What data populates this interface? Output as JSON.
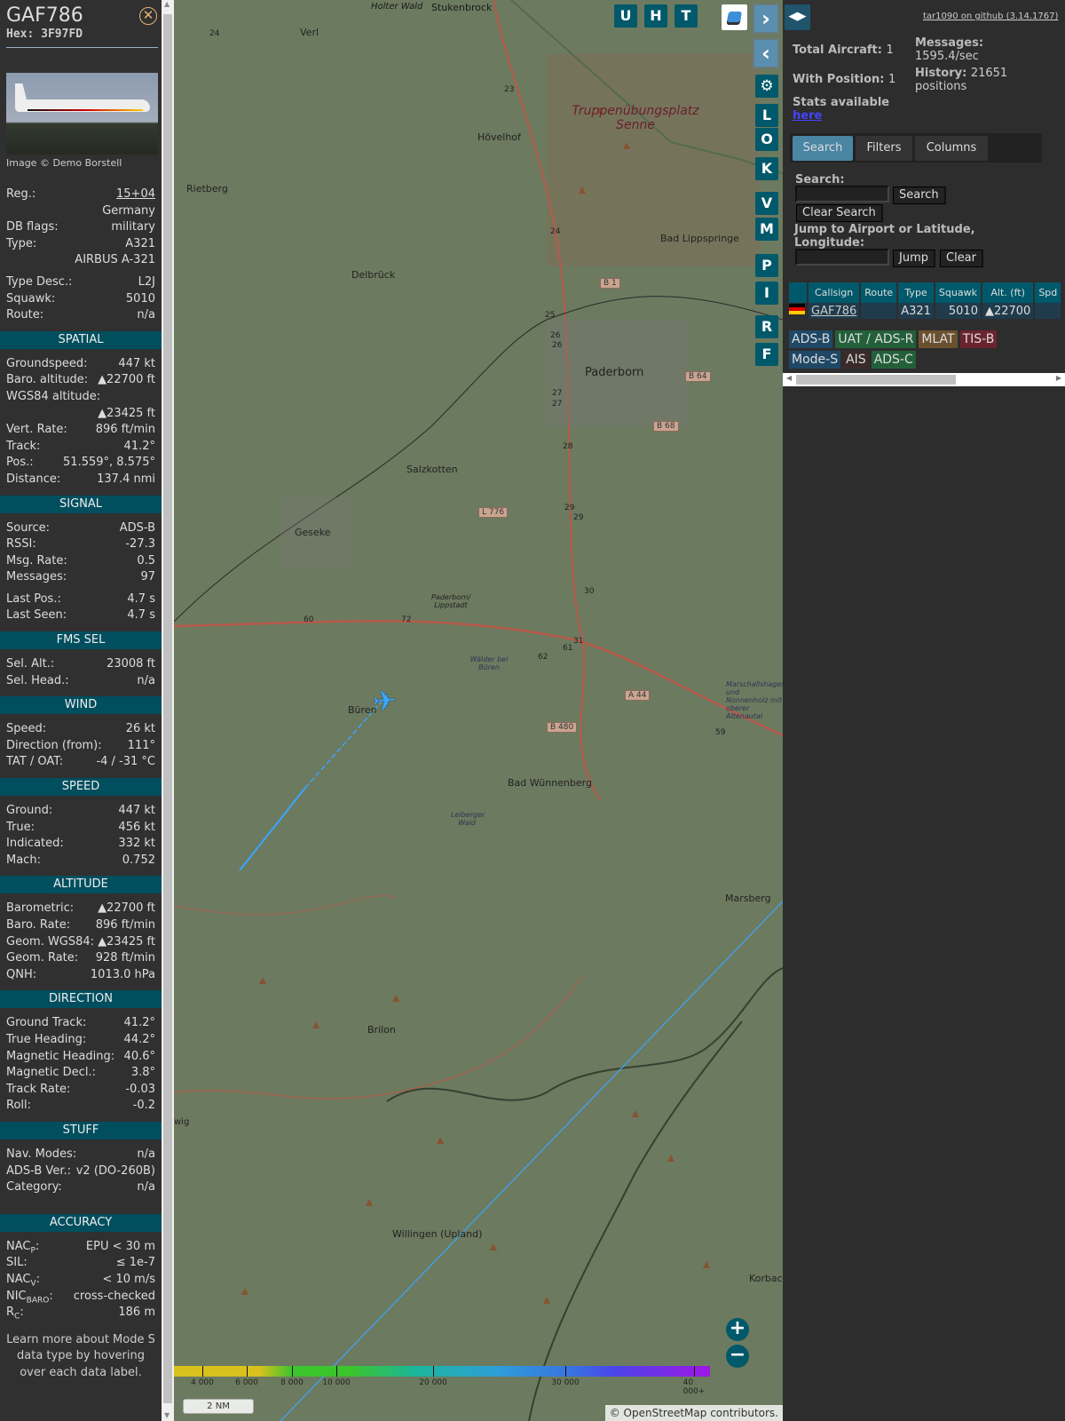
{
  "aircraft": {
    "callsign": "GAF786",
    "hex_label": "Hex: 3F97FD",
    "close_icon": "close-circle-icon",
    "image_caption": "Image © Demo Borstell"
  },
  "details": [
    {
      "type": "row",
      "label": "Reg.:",
      "value": "15+04",
      "link": true
    },
    {
      "type": "row",
      "label": "",
      "value": "Germany"
    },
    {
      "type": "row",
      "label": "DB flags:",
      "value": "military"
    },
    {
      "type": "row",
      "label": "Type:",
      "value": "A321"
    },
    {
      "type": "row",
      "label": "",
      "value": "AIRBUS A-321"
    },
    {
      "type": "gap"
    },
    {
      "type": "row",
      "label": "Type Desc.:",
      "value": "L2J"
    },
    {
      "type": "row",
      "label": "Squawk:",
      "value": "5010"
    },
    {
      "type": "row",
      "label": "Route:",
      "value": "n/a"
    },
    {
      "type": "section",
      "label": "SPATIAL"
    },
    {
      "type": "row",
      "label": "Groundspeed:",
      "value": "447 kt"
    },
    {
      "type": "row",
      "label": "Baro. altitude:",
      "value": "▲22700 ft"
    },
    {
      "type": "row",
      "label": "WGS84 altitude:",
      "value": ""
    },
    {
      "type": "row",
      "label": "",
      "value": "▲23425 ft"
    },
    {
      "type": "row",
      "label": "Vert. Rate:",
      "value": "896 ft/min"
    },
    {
      "type": "row",
      "label": "Track:",
      "value": "41.2°"
    },
    {
      "type": "row",
      "label": "Pos.:",
      "value": "51.559°, 8.575°"
    },
    {
      "type": "row",
      "label": "Distance:",
      "value": "137.4 nmi"
    },
    {
      "type": "section",
      "label": "SIGNAL"
    },
    {
      "type": "row",
      "label": "Source:",
      "value": "ADS-B"
    },
    {
      "type": "row",
      "label": "RSSI:",
      "value": "-27.3"
    },
    {
      "type": "row",
      "label": "Msg. Rate:",
      "value": "0.5"
    },
    {
      "type": "row",
      "label": "Messages:",
      "value": "97"
    },
    {
      "type": "gap"
    },
    {
      "type": "row",
      "label": "Last Pos.:",
      "value": "4.7 s"
    },
    {
      "type": "row",
      "label": "Last Seen:",
      "value": "4.7 s"
    },
    {
      "type": "section",
      "label": "FMS SEL"
    },
    {
      "type": "row",
      "label": "Sel. Alt.:",
      "value": "23008 ft"
    },
    {
      "type": "row",
      "label": "Sel. Head.:",
      "value": "n/a"
    },
    {
      "type": "section",
      "label": "WIND"
    },
    {
      "type": "row",
      "label": "Speed:",
      "value": "26 kt"
    },
    {
      "type": "row",
      "label": "Direction (from):",
      "value": "111°"
    },
    {
      "type": "row",
      "label": "TAT / OAT:",
      "value": "-4 / -31 °C"
    },
    {
      "type": "section",
      "label": "SPEED"
    },
    {
      "type": "row",
      "label": "Ground:",
      "value": "447 kt"
    },
    {
      "type": "row",
      "label": "True:",
      "value": "456 kt"
    },
    {
      "type": "row",
      "label": "Indicated:",
      "value": "332 kt"
    },
    {
      "type": "row",
      "label": "Mach:",
      "value": "0.752"
    },
    {
      "type": "section",
      "label": "ALTITUDE"
    },
    {
      "type": "row",
      "label": "Barometric:",
      "value": "▲22700 ft"
    },
    {
      "type": "row",
      "label": "Baro. Rate:",
      "value": "896 ft/min"
    },
    {
      "type": "row",
      "label": "Geom. WGS84:",
      "value": "▲23425 ft"
    },
    {
      "type": "row",
      "label": "Geom. Rate:",
      "value": "928 ft/min"
    },
    {
      "type": "row",
      "label": "QNH:",
      "value": "1013.0 hPa"
    },
    {
      "type": "section",
      "label": "DIRECTION"
    },
    {
      "type": "row",
      "label": "Ground Track:",
      "value": "41.2°"
    },
    {
      "type": "row",
      "label": "True Heading:",
      "value": "44.2°"
    },
    {
      "type": "row",
      "label": "Magnetic Heading:",
      "value": "40.6°"
    },
    {
      "type": "row",
      "label": "Magnetic Decl.:",
      "value": "3.8°"
    },
    {
      "type": "row",
      "label": "Track Rate:",
      "value": "-0.03"
    },
    {
      "type": "row",
      "label": "Roll:",
      "value": "-0.2"
    },
    {
      "type": "section",
      "label": "STUFF"
    },
    {
      "type": "row",
      "label": "Nav. Modes:",
      "value": "n/a"
    },
    {
      "type": "row",
      "label": "ADS-B Ver.:",
      "value": "v2 (DO-260B)"
    },
    {
      "type": "row",
      "label": "Category:",
      "value": "n/a"
    },
    {
      "type": "gap"
    },
    {
      "type": "gap"
    },
    {
      "type": "section",
      "label": "ACCURACY"
    },
    {
      "type": "row",
      "label": "NAC",
      "sub": "P",
      "suffix": ":",
      "value": "EPU < 30 m"
    },
    {
      "type": "row",
      "label": "SIL:",
      "value": "≤ 1e-7"
    },
    {
      "type": "row",
      "label": "NAC",
      "sub": "V",
      "suffix": ":",
      "value": "< 10 m/s"
    },
    {
      "type": "row",
      "label": "NIC",
      "sub": "BARO",
      "suffix": ":",
      "value": "cross-checked"
    },
    {
      "type": "row",
      "label": "R",
      "sub": "C",
      "suffix": ":",
      "value": "186 m"
    }
  ],
  "footer_note": "Learn more about Mode S data type by hovering over each data label.",
  "map": {
    "top_buttons": [
      "U",
      "H",
      "T"
    ],
    "side_buttons": [
      "L",
      "O",
      "K",
      "V",
      "M",
      "P",
      "I",
      "R",
      "F"
    ],
    "layers_icon": "layers-icon",
    "settings_icon": "gear-icon",
    "zoom_in": "+",
    "zoom_out": "−",
    "scale": "2 NM",
    "attribution_prefix": "© ",
    "attribution_link": "OpenStreetMap",
    "attribution_suffix": " contributors.",
    "altitude_legend": [
      "4 000",
      "6 000",
      "8 000",
      "10 000",
      "20 000",
      "30 000",
      "40 000+"
    ],
    "places": [
      {
        "name": "Verl"
      },
      {
        "name": "Rietberg"
      },
      {
        "name": "Hövelhof"
      },
      {
        "name": "Delbrück"
      },
      {
        "name": "Bad Lippspringe"
      },
      {
        "name": "Paderborn"
      },
      {
        "name": "Salzkotten"
      },
      {
        "name": "Geseke"
      },
      {
        "name": "Paderborn/ Lippstadt"
      },
      {
        "name": "Wälder bei Büren"
      },
      {
        "name": "Büren"
      },
      {
        "name": "Bad Wünnenberg"
      },
      {
        "name": "Leiberger Wald"
      },
      {
        "name": "Marsberg"
      },
      {
        "name": "Brilon"
      },
      {
        "name": "Willingen (Upland)"
      },
      {
        "name": "Korbach"
      },
      {
        "name": "Truppenübungsplatz Senne"
      },
      {
        "name": "Stukenbrock"
      },
      {
        "name": "Holter Wald"
      },
      {
        "name": "Marschallshagen und Nonnenholz mit oberer Altenautal"
      },
      {
        "name": "wig"
      }
    ],
    "road_labels": [
      "B 1",
      "B 64",
      "B 68",
      "L 776",
      "A 44",
      "B 480"
    ],
    "road_numbers": [
      "24",
      "23",
      "24",
      "25",
      "26",
      "26",
      "27",
      "27",
      "28",
      "29",
      "29",
      "30",
      "31",
      "61",
      "62",
      "59",
      "60",
      "72"
    ]
  },
  "stats": {
    "github_link": "tar1090 on github (3.14.1767)",
    "total_aircraft_label": "Total Aircraft:",
    "total_aircraft": "1",
    "with_position_label": "With Position:",
    "with_position": "1",
    "messages_label": "Messages:",
    "messages": "1595.4/sec",
    "history_label": "History:",
    "history": "21651",
    "history_unit": "positions",
    "stats_label": "Stats available",
    "stats_link": "here"
  },
  "tabs": [
    "Search",
    "Filters",
    "Columns"
  ],
  "search": {
    "search_label": "Search:",
    "search_value": "",
    "search_button": "Search",
    "clear_search": "Clear Search",
    "jump_label": "Jump to Airport or Latitude, Longitude:",
    "jump_value": "",
    "jump_button": "Jump",
    "clear_button": "Clear"
  },
  "table": {
    "columns": [
      "",
      "Callsign",
      "Route",
      "Type",
      "Squawk",
      "Alt. (ft)",
      "Spd"
    ],
    "rows": [
      {
        "flag": "Germany",
        "callsign": "GAF786",
        "route": "",
        "type": "A321",
        "squawk": "5010",
        "alt": "▲22700",
        "spd": ""
      }
    ]
  },
  "source_badges": [
    {
      "label": "ADS-B",
      "color": "#1f4866"
    },
    {
      "label": "UAT / ADS-R",
      "color": "#23603a"
    },
    {
      "label": "MLAT",
      "color": "#6b5030"
    },
    {
      "label": "TIS-B",
      "color": "#6a2430"
    },
    {
      "label": "Mode-S",
      "color": "#1f4866"
    },
    {
      "label": "AIS",
      "color": "#3a2a2a"
    },
    {
      "label": "ADS-C",
      "color": "#23603a"
    }
  ]
}
